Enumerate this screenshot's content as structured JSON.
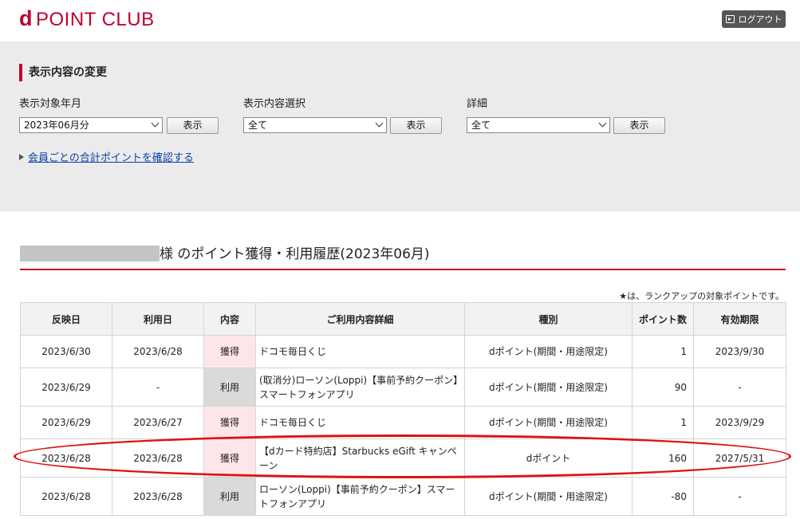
{
  "header": {
    "logo_d": "d",
    "logo_text": "POINT CLUB",
    "logout_label": "ログアウト"
  },
  "filters": {
    "title": "表示内容の変更",
    "period": {
      "label": "表示対象年月",
      "value": "2023年06月分",
      "button": "表示"
    },
    "content": {
      "label": "表示内容選択",
      "value": "全て",
      "button": "表示"
    },
    "detail": {
      "label": "詳細",
      "value": "全て",
      "button": "表示"
    },
    "member_link": "会員ごとの合計ポイントを確認する"
  },
  "section": {
    "title": "様 のポイント獲得・利用履歴(2023年06月)",
    "note": "★は、ランクアップの対象ポイントです。"
  },
  "table": {
    "headers": [
      "反映日",
      "利用日",
      "内容",
      "ご利用内容詳細",
      "種別",
      "ポイント数",
      "有効期限"
    ],
    "rows": [
      {
        "reflect": "2023/6/30",
        "use": "2023/6/28",
        "kind": "獲得",
        "type": "get",
        "detail": "ドコモ毎日くじ",
        "category": "dポイント(期間・用途限定)",
        "points": "1",
        "expiry": "2023/9/30"
      },
      {
        "reflect": "2023/6/29",
        "use": "-",
        "kind": "利用",
        "type": "use",
        "detail": "(取消分)ローソン(Loppi)【事前予約クーポン】スマートフォンアプリ",
        "category": "dポイント(期間・用途限定)",
        "points": "90",
        "expiry": "-"
      },
      {
        "reflect": "2023/6/29",
        "use": "2023/6/27",
        "kind": "獲得",
        "type": "get",
        "detail": "ドコモ毎日くじ",
        "category": "dポイント(期間・用途限定)",
        "points": "1",
        "expiry": "2023/9/29"
      },
      {
        "reflect": "2023/6/28",
        "use": "2023/6/28",
        "kind": "獲得",
        "type": "get",
        "detail": "【dカード特約店】Starbucks eGift キャンペーン",
        "category": "dポイント",
        "points": "160",
        "expiry": "2027/5/31"
      },
      {
        "reflect": "2023/6/28",
        "use": "2023/6/28",
        "kind": "利用",
        "type": "use",
        "detail": "ローソン(Loppi)【事前予約クーポン】スマートフォンアプリ",
        "category": "dポイント(期間・用途限定)",
        "points": "-80",
        "expiry": "-"
      }
    ]
  }
}
